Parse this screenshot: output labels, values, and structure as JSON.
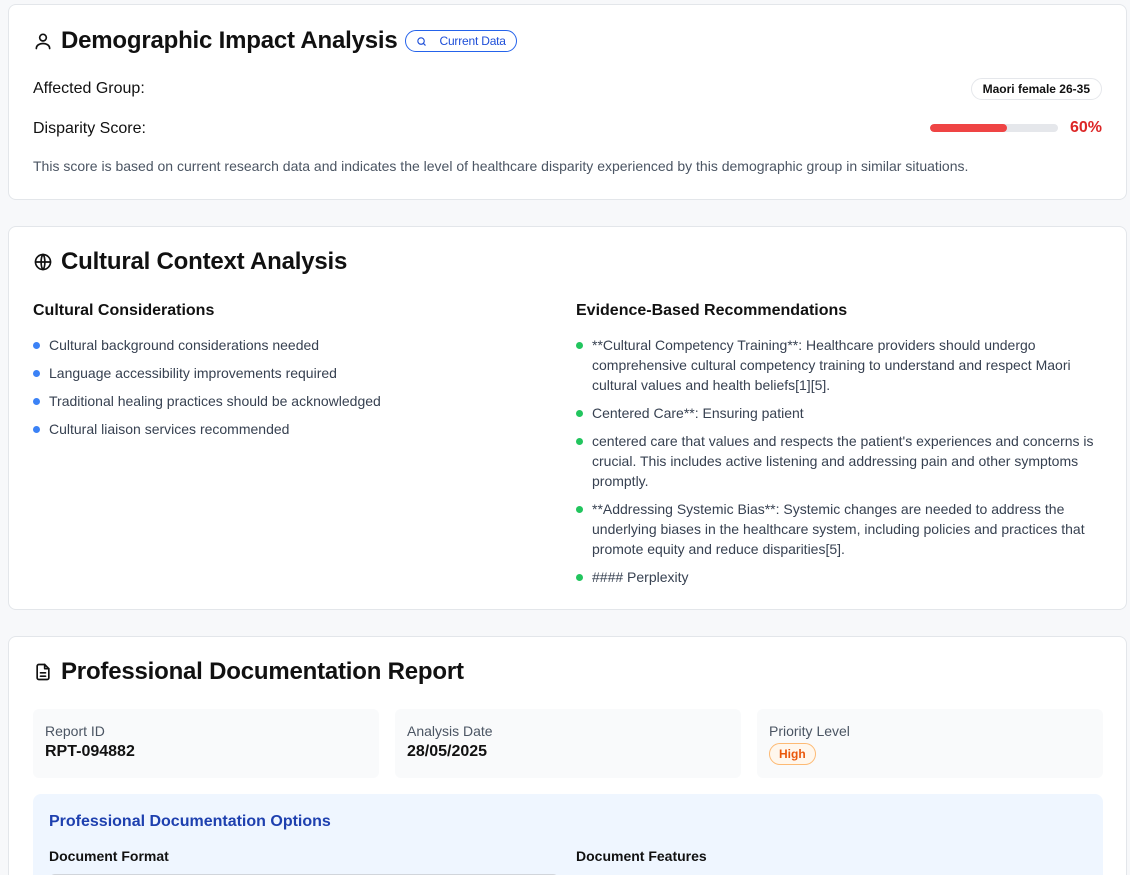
{
  "demographic": {
    "title": "Demographic Impact Analysis",
    "badge": "Current Data",
    "affected_group_label": "Affected Group:",
    "affected_group_value": "Maori female 26-35",
    "disparity_label": "Disparity Score:",
    "disparity_value": "60%",
    "disparity_fraction": 0.6,
    "note": "This score is based on current research data and indicates the level of healthcare disparity experienced by this demographic group in similar situations."
  },
  "cultural": {
    "title": "Cultural Context Analysis",
    "considerations_heading": "Cultural Considerations",
    "considerations": [
      "Cultural background considerations needed",
      "Language accessibility improvements required",
      "Traditional healing practices should be acknowledged",
      "Cultural liaison services recommended"
    ],
    "recommendations_heading": "Evidence-Based Recommendations",
    "recommendations": [
      "**Cultural Competency Training**: Healthcare providers should undergo comprehensive cultural competency training to understand and respect Maori cultural values and health beliefs[1][5].",
      "Centered Care**: Ensuring patient",
      "centered care that values and respects the patient's experiences and concerns is crucial. This includes active listening and addressing pain and other symptoms promptly.",
      "**Addressing Systemic Bias**: Systemic changes are needed to address the underlying biases in the healthcare system, including policies and practices that promote equity and reduce disparities[5].",
      "#### Perplexity"
    ]
  },
  "report": {
    "title": "Professional Documentation Report",
    "report_id_label": "Report ID",
    "report_id": "RPT-094882",
    "date_label": "Analysis Date",
    "date": "28/05/2025",
    "priority_label": "Priority Level",
    "priority": "High",
    "options_title": "Professional Documentation Options",
    "format_heading": "Document Format",
    "features_heading": "Document Features"
  },
  "colors": {
    "accent_blue": "#2563eb",
    "danger_red": "#ef4444",
    "success_green": "#22c55e",
    "priority_orange": "#ea580c"
  }
}
